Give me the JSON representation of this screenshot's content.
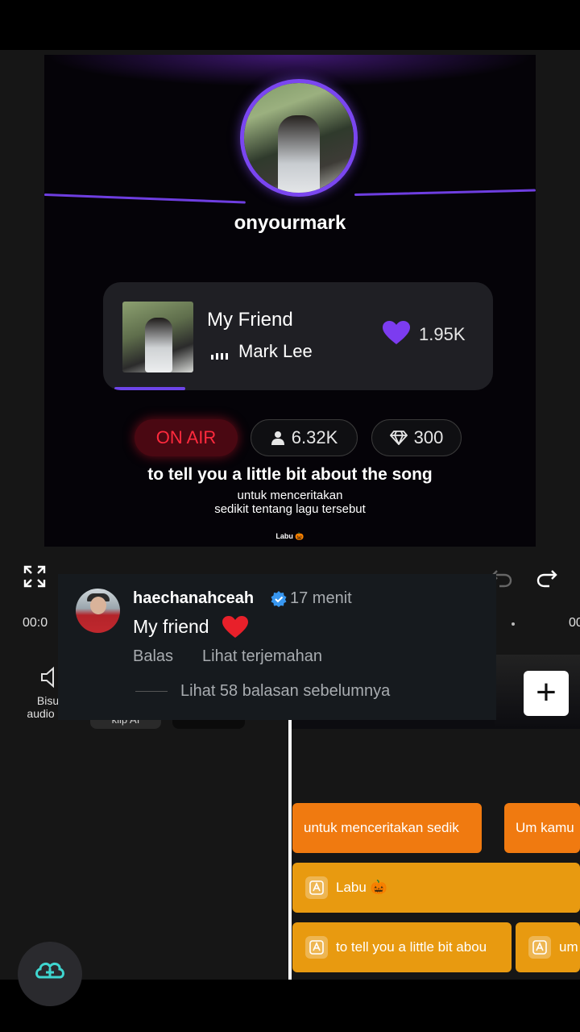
{
  "preview": {
    "username": "onyourmark",
    "song": {
      "title": "My Friend",
      "artist": "Mark Lee",
      "likes": "1.95K"
    },
    "badges": {
      "onair": "ON AIR",
      "viewers": "6.32K",
      "gems": "300"
    },
    "caption": {
      "main": "to tell you a little bit about the song",
      "sub_line1": "untuk menceritakan",
      "sub_line2": "sedikit tentang lagu tersebut"
    },
    "watermark": "Labu 🎃"
  },
  "timeline": {
    "time_left": "00:0",
    "time_right": "00"
  },
  "tools": {
    "mute_label_1": "Bisuk",
    "mute_label_2": "audio klip",
    "ai_label": "klip AI"
  },
  "tracks": {
    "sub1": "untuk menceritakan sedik",
    "sub2": "Um kamu",
    "labu": "Labu 🎃",
    "text1": "to tell you a little bit abou",
    "text2": "um"
  },
  "comment": {
    "username": "haechanahceah",
    "time": "17 menit",
    "text": "My friend",
    "reply": "Balas",
    "translate": "Lihat terjemahan",
    "more_replies": "Lihat 58 balasan sebelumnya"
  },
  "colors": {
    "accent_purple": "#7a46f0",
    "onair_red": "#ff2a3d",
    "track_orange": "#f07a10",
    "track_yellow": "#e89a10"
  }
}
